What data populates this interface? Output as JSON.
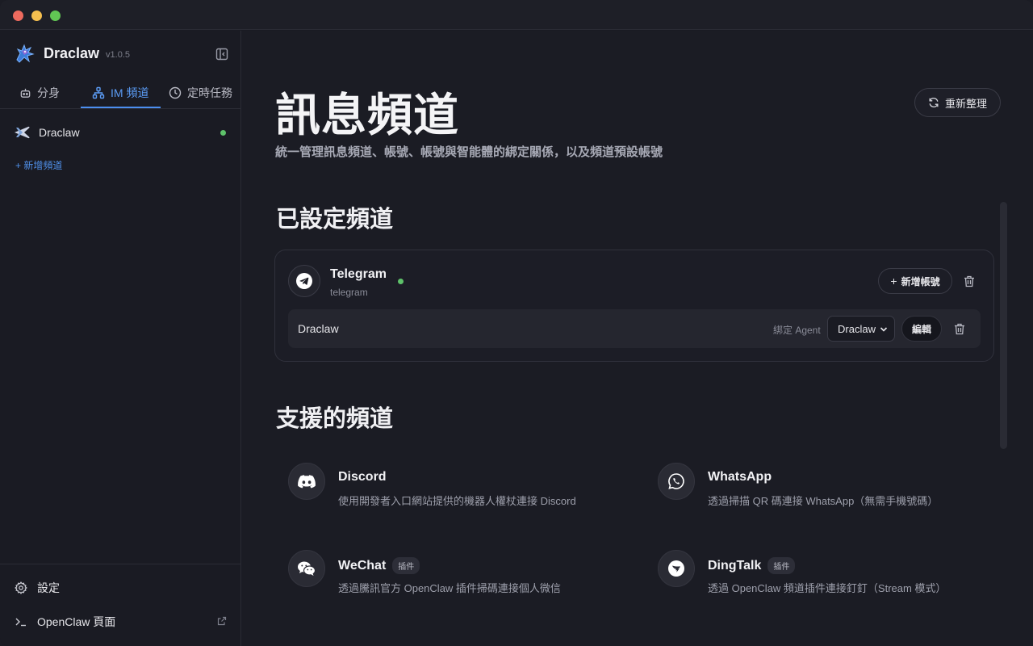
{
  "app": {
    "name": "Draclaw",
    "version": "v1.0.5"
  },
  "sidebar": {
    "tabs": [
      {
        "label": "分身",
        "icon": "robot-icon"
      },
      {
        "label": "IM 頻道",
        "icon": "network-icon"
      },
      {
        "label": "定時任務",
        "icon": "clock-icon"
      }
    ],
    "active_tab": 1,
    "channels": [
      {
        "label": "Draclaw",
        "icon": "airplane-icon",
        "status": "online"
      }
    ],
    "add_channel": "+ 新增頻道",
    "footer": {
      "settings": "設定",
      "openclaw_page": "OpenClaw 頁面"
    }
  },
  "main": {
    "title": "訊息頻道",
    "subtitle": "統一管理訊息頻道、帳號、帳號與智能體的綁定關係，以及頻道預設帳號",
    "refresh": "重新整理",
    "configured_section": "已設定頻道",
    "configured": [
      {
        "name": "Telegram",
        "id": "telegram",
        "status": "online",
        "add_account": "新增帳號",
        "accounts": [
          {
            "name": "Draclaw",
            "bind_label": "綁定 Agent",
            "agent": "Draclaw",
            "edit": "編輯"
          }
        ]
      }
    ],
    "supported_section": "支援的頻道",
    "supported": [
      {
        "name": "Discord",
        "desc": "使用開發者入口網站提供的機器人權杖連接 Discord",
        "badge": "",
        "icon": "discord-icon"
      },
      {
        "name": "WhatsApp",
        "desc": "透過掃描 QR 碼連接 WhatsApp（無需手機號碼）",
        "badge": "",
        "icon": "whatsapp-icon"
      },
      {
        "name": "WeChat",
        "desc": "透過騰訊官方 OpenClaw 插件掃碼連接個人微信",
        "badge": "插件",
        "icon": "wechat-icon"
      },
      {
        "name": "DingTalk",
        "desc": "透過 OpenClaw 頻道插件連接釘釘（Stream 模式）",
        "badge": "插件",
        "icon": "dingtalk-icon"
      }
    ]
  },
  "colors": {
    "accent": "#4c8eef",
    "online": "#5ec26a",
    "background": "#1b1c24"
  }
}
